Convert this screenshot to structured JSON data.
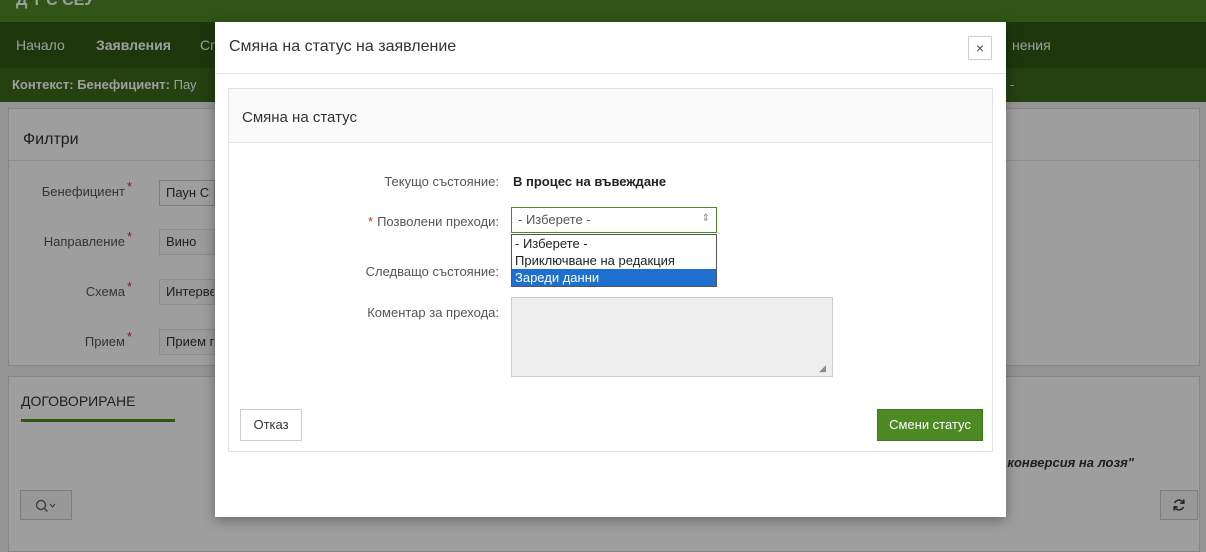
{
  "app": {
    "title": "Д Т С СЕУ",
    "nav": [
      "Начало",
      "Заявления",
      "Сп",
      "нения"
    ],
    "context_label": "Контекст: Бенефициент:",
    "context_value": "Пау",
    "context_dash": "-"
  },
  "filters": {
    "title": "Филтри",
    "fields": [
      {
        "label": "Бенефициент",
        "value": "Паун С"
      },
      {
        "label": "Направление",
        "value": "Вино"
      },
      {
        "label": "Схема",
        "value": "Интерве"
      },
      {
        "label": "Прием",
        "value": "Прием г"
      }
    ]
  },
  "tabs": {
    "active": "ДОГОВОРИРАНЕ",
    "note": "е и конверсия на лозя\""
  },
  "icons": {
    "search": "search-icon",
    "refresh": "refresh-icon",
    "close": "close-icon"
  },
  "modal": {
    "title": "Смяна на статус на заявление",
    "close_glyph": "×",
    "section_title": "Смяна на статус",
    "current_state_label": "Текущо състояние:",
    "current_state_value": "В процес на въвеждане",
    "transitions_label": "Позволени преходи:",
    "transitions_selected": "- Изберете -",
    "transitions_options": [
      "- Изберете -",
      "Приключване на редакция",
      "Зареди данни"
    ],
    "highlighted_option": "Зареди данни",
    "next_state_label": "Следващо състояние:",
    "comment_label": "Коментар за прехода:",
    "comment_value": "",
    "cancel_label": "Отказ",
    "submit_label": "Смени статус"
  },
  "colors": {
    "brand_green": "#4e8a24",
    "nav_dark": "#2f5a13",
    "highlight_blue": "#1f6fd1",
    "required_red": "#c0392b"
  }
}
